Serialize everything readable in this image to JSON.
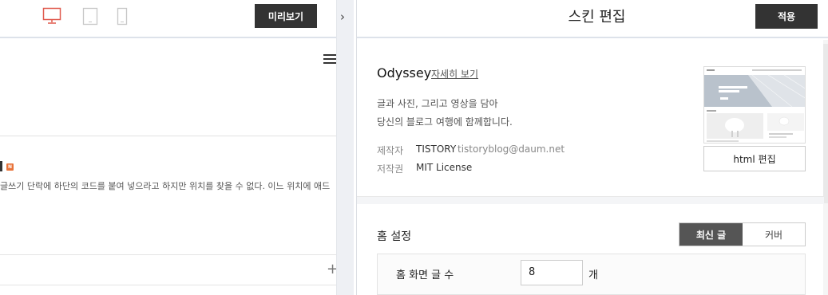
{
  "toolbar": {
    "preview_label": "미리보기",
    "devices": [
      "desktop-icon",
      "tablet-icon",
      "mobile-icon"
    ],
    "collapse_glyph": "›"
  },
  "preview": {
    "post_excerpt": "글쓰기 단락에 하단의 코드를 붙여 넣으라고 하지만 위치를 찾을 수 없다. 이느 위치에 애드",
    "new_badge": "N",
    "add_glyph": "+"
  },
  "editor": {
    "title": "스킨 편집",
    "apply_label": "적용",
    "skin": {
      "name": "Odyssey",
      "detail_link": "자세히 보기",
      "desc_line1": "글과 사진, 그리고 영상을 담아",
      "desc_line2": "당신의 블로그 여행에 함께합니다.",
      "maker_label": "제작자",
      "maker_value": "TISTORY",
      "maker_email": "tistoryblog@daum.net",
      "license_label": "저작권",
      "license_value": "MIT License"
    },
    "html_edit_label": "html 편집",
    "home": {
      "title": "홈 설정",
      "tab_recent": "최신 글",
      "tab_cover": "커버",
      "count_label": "홈 화면 글 수",
      "count_value": "8",
      "count_unit": "개"
    }
  },
  "colors": {
    "dark_button": "#333333",
    "active_device": "#e05a4e",
    "inactive_device": "#c7c7c7",
    "segment_active": "#555555"
  }
}
